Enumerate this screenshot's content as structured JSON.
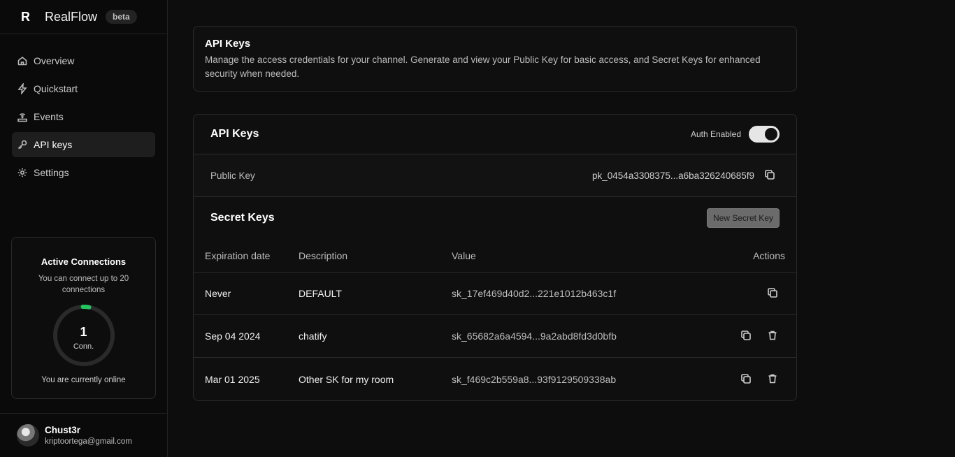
{
  "brand": {
    "logo": "R",
    "name": "RealFlow",
    "badge": "beta"
  },
  "nav": [
    {
      "label": "Overview",
      "icon": "home-icon",
      "active": false
    },
    {
      "label": "Quickstart",
      "icon": "bolt-icon",
      "active": false
    },
    {
      "label": "Events",
      "icon": "broadcast-icon",
      "active": false
    },
    {
      "label": "API keys",
      "icon": "key-icon",
      "active": true
    },
    {
      "label": "Settings",
      "icon": "gear-icon",
      "active": false
    }
  ],
  "connections": {
    "title": "Active Connections",
    "subtitle": "You can connect up to 20 connections",
    "count": "1",
    "unit": "Conn.",
    "max": 20,
    "status": "You are currently online",
    "accent": "#22c55e"
  },
  "user": {
    "name": "Chust3r",
    "email": "kriptoortega@gmail.com"
  },
  "info": {
    "title": "API Keys",
    "description": "Manage the access credentials for your channel. Generate and view your Public Key for basic access, and Secret Keys for enhanced security when needed."
  },
  "keys": {
    "title": "API Keys",
    "auth_label": "Auth Enabled",
    "auth_enabled": true,
    "public_key_label": "Public Key",
    "public_key_value": "pk_0454a3308375...a6ba326240685f9"
  },
  "secret": {
    "title": "Secret Keys",
    "new_button": "New Secret Key",
    "columns": [
      "Expiration date",
      "Description",
      "Value",
      "Actions"
    ],
    "rows": [
      {
        "expiration": "Never",
        "description": "DEFAULT",
        "value": "sk_17ef469d40d2...221e1012b463c1f",
        "deletable": false
      },
      {
        "expiration": "Sep 04 2024",
        "description": "chatify",
        "value": "sk_65682a6a4594...9a2abd8fd3d0bfb",
        "deletable": true
      },
      {
        "expiration": "Mar 01 2025",
        "description": "Other SK for my room",
        "value": "sk_f469c2b559a8...93f9129509338ab",
        "deletable": true
      }
    ]
  }
}
